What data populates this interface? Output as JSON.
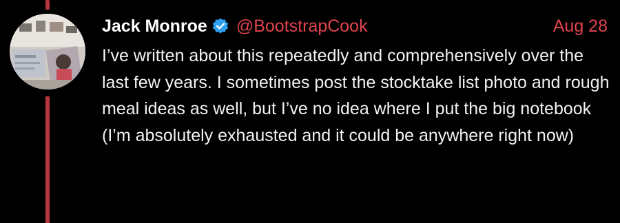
{
  "tweet": {
    "author": {
      "display_name": "Jack Monroe",
      "handle": "@BootstrapCook",
      "verified": true
    },
    "date": "Aug 28",
    "text": "I’ve written about this repeatedly and comprehensively over the last few years. I sometimes post the stocktake list photo and rough meal ideas as well, but I’ve no idea where I put the big notebook (I’m absolutely exhausted and it could be anywhere right now)"
  },
  "icons": {
    "verified": "verified-badge-icon",
    "avatar": "avatar"
  },
  "colors": {
    "background": "#000000",
    "text": "#ffffff",
    "accent": "#e1434f",
    "thread_line": "#b8353b",
    "verified_badge": "#2e9ff0"
  }
}
